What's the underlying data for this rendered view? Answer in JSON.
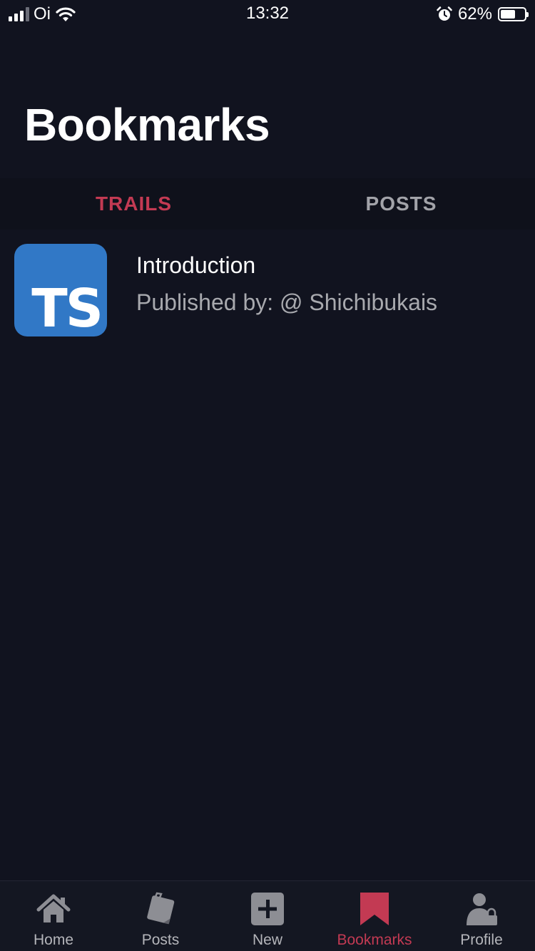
{
  "status_bar": {
    "carrier": "Oi",
    "time": "13:32",
    "battery_percent": "62%",
    "battery_level": 0.62,
    "signal_bars_active": 3,
    "signal_bars_total": 4
  },
  "page": {
    "title": "Bookmarks"
  },
  "tabs": [
    {
      "label": "TRAILS",
      "active": true
    },
    {
      "label": "POSTS",
      "active": false
    }
  ],
  "list": {
    "items": [
      {
        "logo_text": "TS",
        "title": "Introduction",
        "subtitle": "Published by: @ Shichibukais"
      }
    ]
  },
  "bottom_nav": {
    "items": [
      {
        "label": "Home",
        "icon": "home-icon",
        "active": false
      },
      {
        "label": "Posts",
        "icon": "posts-icon",
        "active": false
      },
      {
        "label": "New",
        "icon": "plus-icon",
        "active": false
      },
      {
        "label": "Bookmarks",
        "icon": "bookmark-icon",
        "active": true
      },
      {
        "label": "Profile",
        "icon": "profile-lock-icon",
        "active": false
      }
    ]
  },
  "colors": {
    "background": "#11131f",
    "accent": "#c33a53",
    "inactive": "#a2a3a9",
    "nav_icon": "#8d8e94",
    "typescript_blue": "#3178c6"
  }
}
